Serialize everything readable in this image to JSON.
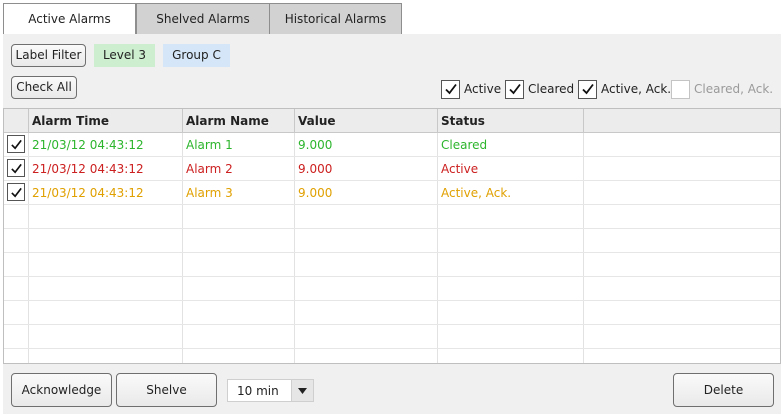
{
  "tabs": [
    {
      "label": "Active Alarms",
      "active": true
    },
    {
      "label": "Shelved Alarms",
      "active": false
    },
    {
      "label": "Historical Alarms",
      "active": false
    }
  ],
  "toolbar": {
    "label_filter": "Label Filter",
    "chip_level": "Level 3",
    "chip_group": "Group C",
    "check_all": "Check All"
  },
  "filters": [
    {
      "label": "Active",
      "checked": true
    },
    {
      "label": "Cleared",
      "checked": true
    },
    {
      "label": "Active, Ack.",
      "checked": true
    },
    {
      "label": "Cleared, Ack.",
      "checked": false
    }
  ],
  "table": {
    "columns": [
      "Alarm Time",
      "Alarm Name",
      "Value",
      "Status"
    ],
    "rows": [
      {
        "checked": true,
        "time": "21/03/12 04:43:12",
        "name": "Alarm 1",
        "value": "9.000",
        "status": "Cleared",
        "color": "#2db52d"
      },
      {
        "checked": true,
        "time": "21/03/12 04:43:12",
        "name": "Alarm 2",
        "value": "9.000",
        "status": "Active",
        "color": "#cc1f1f"
      },
      {
        "checked": true,
        "time": "21/03/12 04:43:12",
        "name": "Alarm 3",
        "value": "9.000",
        "status": "Active, Ack.",
        "color": "#e0a000"
      }
    ]
  },
  "footer": {
    "acknowledge": "Acknowledge",
    "shelve": "Shelve",
    "shelve_duration": "10 min",
    "delete": "Delete"
  },
  "colors": {
    "cleared": "#2db52d",
    "active": "#cc1f1f",
    "active_ack": "#e0a000"
  }
}
